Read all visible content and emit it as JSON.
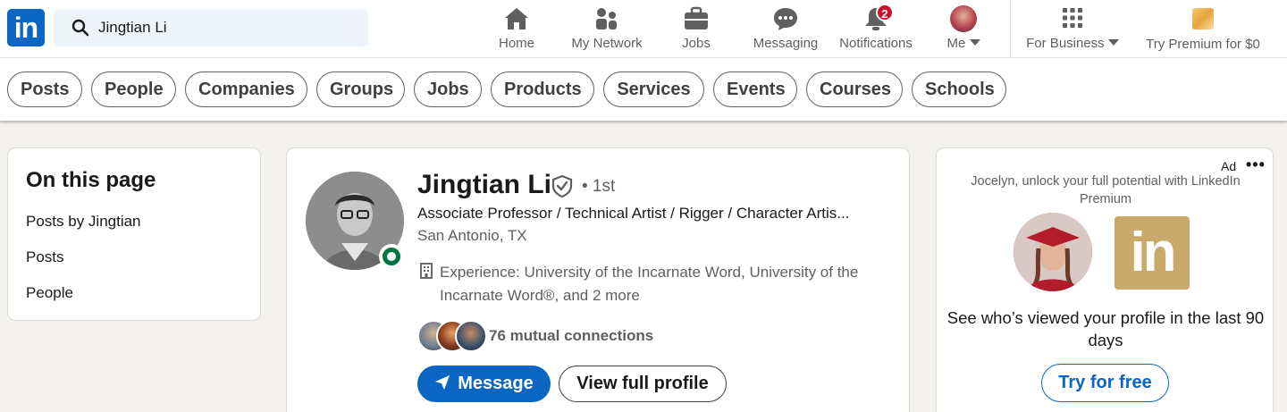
{
  "nav": {
    "logo_text": "in",
    "search_value": "Jingtian Li",
    "items": [
      {
        "label": "Home",
        "icon": "home-icon"
      },
      {
        "label": "My Network",
        "icon": "network-icon"
      },
      {
        "label": "Jobs",
        "icon": "briefcase-icon"
      },
      {
        "label": "Messaging",
        "icon": "messaging-icon"
      },
      {
        "label": "Notifications",
        "icon": "bell-icon",
        "badge": "2"
      },
      {
        "label": "Me",
        "icon": "avatar"
      }
    ],
    "business_label": "For Business",
    "premium_label": "Try Premium for $0"
  },
  "filters": [
    "Posts",
    "People",
    "Companies",
    "Groups",
    "Jobs",
    "Products",
    "Services",
    "Events",
    "Courses",
    "Schools"
  ],
  "on_this_page": {
    "title": "On this page",
    "links": [
      "Posts by Jingtian",
      "Posts",
      "People"
    ]
  },
  "profile": {
    "name": "Jingtian Li",
    "degree": "• 1st",
    "headline": "Associate Professor / Technical Artist / Rigger / Character Artis...",
    "location": "San Antonio, TX",
    "experience": "Experience: University of the Incarnate Word, University of the Incarnate Word®, and 2 more",
    "mutual": "76 mutual connections",
    "message_label": "Message",
    "view_label": "View full profile"
  },
  "ad": {
    "label": "Ad",
    "more": "•••",
    "subtitle": "Jocelyn, unlock your full potential with LinkedIn Premium",
    "logo_text": "in",
    "text": "See who’s viewed your profile in the last 90 days",
    "button": "Try for free"
  },
  "colors": {
    "brand": "#0a66c2",
    "online": "#057642",
    "badge": "#cb112d",
    "premium_gold": "#c9aa6a"
  }
}
